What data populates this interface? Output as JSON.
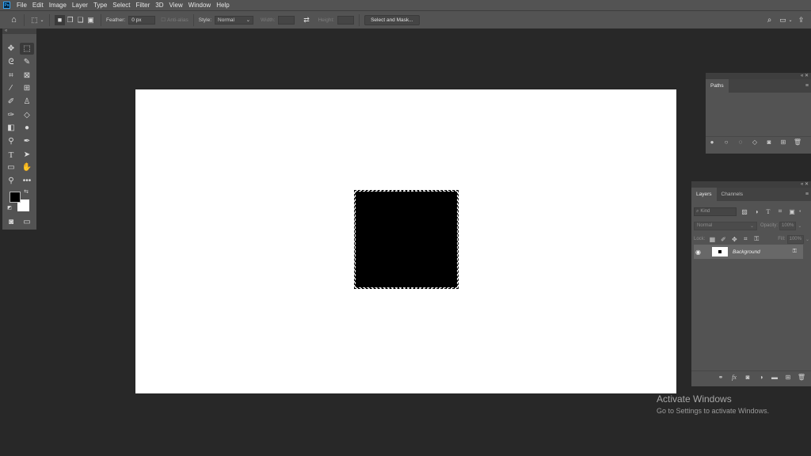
{
  "app": {
    "logo": "Ps"
  },
  "menu": [
    "File",
    "Edit",
    "Image",
    "Layer",
    "Type",
    "Select",
    "Filter",
    "3D",
    "View",
    "Window",
    "Help"
  ],
  "options": {
    "feather_label": "Feather:",
    "feather_value": "0 px",
    "antialias_label": "Anti-alias",
    "style_label": "Style:",
    "style_value": "Normal",
    "width_label": "Width:",
    "height_label": "Height:",
    "select_mask_label": "Select and Mask..."
  },
  "paths_panel": {
    "tab": "Paths"
  },
  "layers_panel": {
    "tabs": [
      "Layers",
      "Channels"
    ],
    "search_placeholder": "Kind",
    "blend_mode": "Normal",
    "opacity_label": "Opacity:",
    "opacity_value": "100%",
    "lock_label": "Lock:",
    "fill_label": "Fill:",
    "fill_value": "100%",
    "layers": [
      {
        "name": "Background"
      }
    ]
  },
  "watermark": {
    "title": "Activate Windows",
    "subtitle": "Go to Settings to activate Windows."
  },
  "colors": {
    "foreground": "#000000",
    "background": "#ffffff"
  }
}
